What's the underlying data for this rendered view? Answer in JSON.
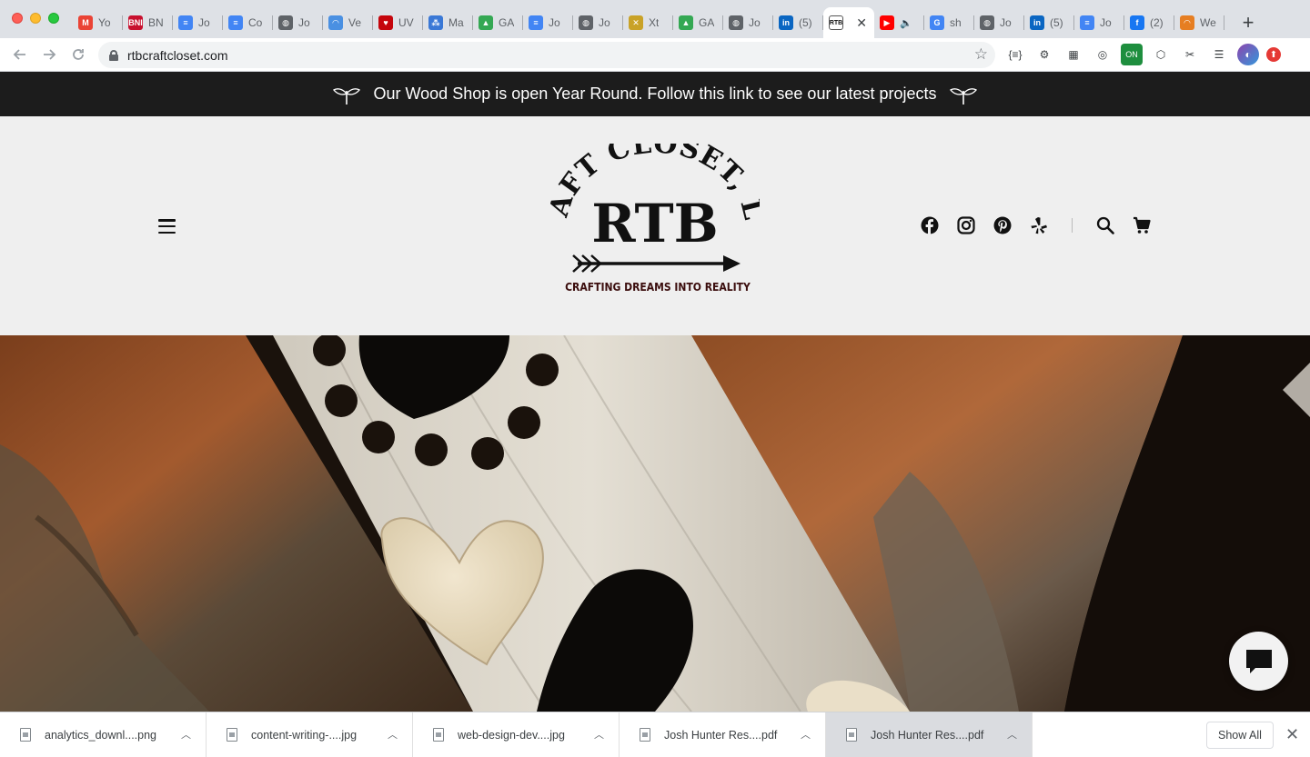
{
  "browser": {
    "tabs": [
      {
        "label": "Yo",
        "favicon": "gmail-icon",
        "color": "#ea4335",
        "glyph": "M"
      },
      {
        "label": "BN",
        "favicon": "bni-icon",
        "color": "#c8102e",
        "glyph": "BNI"
      },
      {
        "label": "Jo",
        "favicon": "docs-icon",
        "color": "#4285f4",
        "glyph": "≡"
      },
      {
        "label": "Co",
        "favicon": "docs-icon",
        "color": "#4285f4",
        "glyph": "≡"
      },
      {
        "label": "Jo",
        "favicon": "globe-icon",
        "color": "#5f6368",
        "glyph": "◍"
      },
      {
        "label": "Ve",
        "favicon": "loading-icon",
        "color": "#4a90e2",
        "glyph": "◠"
      },
      {
        "label": "UV",
        "favicon": "uw-icon",
        "color": "#c5050c",
        "glyph": "♥"
      },
      {
        "label": "Ma",
        "favicon": "meetup-icon",
        "color": "#3a78d6",
        "glyph": "⁂"
      },
      {
        "label": "GA",
        "favicon": "drive-icon",
        "color": "#34a853",
        "glyph": "▲"
      },
      {
        "label": "Jo",
        "favicon": "docs-icon",
        "color": "#4285f4",
        "glyph": "≡"
      },
      {
        "label": "Jo",
        "favicon": "globe-icon",
        "color": "#5f6368",
        "glyph": "◍"
      },
      {
        "label": "Xt",
        "favicon": "xtensio-icon",
        "color": "#c9a227",
        "glyph": "✕"
      },
      {
        "label": "GA",
        "favicon": "drive-icon",
        "color": "#34a853",
        "glyph": "▲"
      },
      {
        "label": "Jo",
        "favicon": "globe-icon",
        "color": "#5f6368",
        "glyph": "◍"
      },
      {
        "label": "(5)",
        "favicon": "linkedin-icon",
        "color": "#0a66c2",
        "glyph": "in"
      }
    ],
    "active_tab": {
      "favicon": "rtb-icon",
      "close": "✕"
    },
    "tabs_right": [
      {
        "label": "",
        "favicon": "youtube-icon",
        "color": "#ff0000",
        "glyph": "▶",
        "extra": "🔈"
      },
      {
        "label": "sh",
        "favicon": "google-icon",
        "color": "#4285f4",
        "glyph": "G"
      },
      {
        "label": "Jo",
        "favicon": "globe-icon",
        "color": "#5f6368",
        "glyph": "◍"
      },
      {
        "label": "(5)",
        "favicon": "linkedin-icon",
        "color": "#0a66c2",
        "glyph": "in"
      },
      {
        "label": "Jo",
        "favicon": "docs-icon",
        "color": "#4285f4",
        "glyph": "≡"
      },
      {
        "label": "(2)",
        "favicon": "facebook-icon",
        "color": "#1877f2",
        "glyph": "f"
      },
      {
        "label": "We",
        "favicon": "rainbow-icon",
        "color": "#e67e22",
        "glyph": "◠"
      }
    ],
    "new_tab": "+",
    "url": "rtbcraftcloset.com",
    "extensions": [
      "{≡}",
      "⚙",
      "▦",
      "◎",
      "ON",
      "⬡",
      "✂",
      "☰",
      "◐",
      "⬆"
    ]
  },
  "site": {
    "announcement": "Our Wood Shop is open Year Round. Follow this link to see our latest projects",
    "logo": {
      "arc_text": "CRAFT CLOSET, LLC",
      "main": "RTB",
      "tagline": "CRAFTING DREAMS INTO REALITY"
    },
    "socials": [
      "facebook",
      "instagram",
      "pinterest",
      "yelp"
    ]
  },
  "downloads": {
    "items": [
      {
        "name": "analytics_downl....png"
      },
      {
        "name": "content-writing-....jpg"
      },
      {
        "name": "web-design-dev....jpg"
      },
      {
        "name": "Josh Hunter Res....pdf"
      },
      {
        "name": "Josh Hunter Res....pdf"
      }
    ],
    "show_all": "Show All"
  },
  "colors": {
    "announcement_bg": "#1c1c1c",
    "header_bg": "#efefef"
  }
}
